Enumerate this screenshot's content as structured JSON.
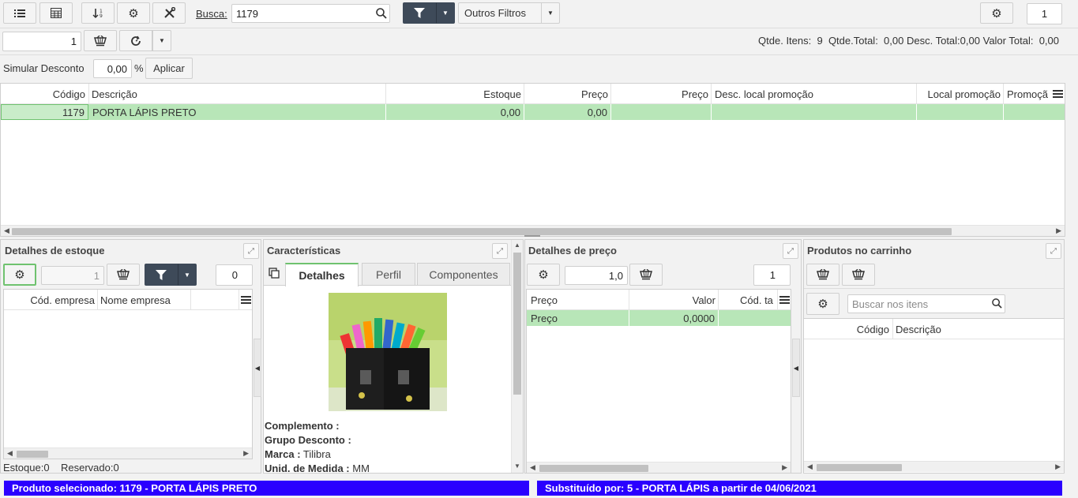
{
  "toolbar": {
    "search_label": "Busca:",
    "search_value": "1179",
    "other_filters_label": "Outros Filtros",
    "page_number": "1"
  },
  "row2": {
    "quantity_value": "1",
    "summary": {
      "items_label": "Qtde. Itens:",
      "items_value": "9",
      "total_label": "Qtde.Total:",
      "total_value": "0,00",
      "desc_label": "Desc. Total:",
      "desc_value": "0,00",
      "valor_label": "Valor Total:",
      "valor_value": "0,00"
    }
  },
  "discount": {
    "label": "Simular Desconto",
    "value": "0,00",
    "percent": "%",
    "apply_label": "Aplicar"
  },
  "main_table": {
    "headers": [
      "Código",
      "Descrição",
      "Estoque",
      "Preço",
      "Preço",
      "Desc. local promoção",
      "Local promoção",
      "Promoçã"
    ],
    "rows": [
      {
        "codigo": "1179",
        "descricao": "PORTA LÁPIS PRETO",
        "estoque": "0,00",
        "preco": "0,00"
      }
    ]
  },
  "stock_panel": {
    "title": "Detalhes de estoque",
    "qty_value": "1",
    "count_value": "0",
    "headers": [
      "Cód. empresa",
      "Nome empresa"
    ],
    "footer_stock": "Estoque:0",
    "footer_reserved": "Reservado:0"
  },
  "features_panel": {
    "title": "Características",
    "tabs": [
      "Detalhes",
      "Perfil",
      "Componentes"
    ],
    "fields": [
      {
        "label": "Complemento :",
        "value": ""
      },
      {
        "label": "Grupo Desconto :",
        "value": ""
      },
      {
        "label": "Marca :",
        "value": "Tilibra"
      },
      {
        "label": "Unid. de Medida :",
        "value": "MM"
      }
    ]
  },
  "price_panel": {
    "title": "Detalhes de preço",
    "qty_value": "1,0",
    "count_value": "1",
    "headers": [
      "Preço",
      "Valor",
      "Cód. ta"
    ],
    "rows": [
      {
        "preco": "Preço",
        "valor": "0,0000"
      }
    ]
  },
  "cart_panel": {
    "title": "Produtos no carrinho",
    "search_placeholder": "Buscar nos itens",
    "headers": [
      "Código",
      "Descrição"
    ]
  },
  "status_bar": {
    "selected": "Produto selecionado: 1179 - PORTA LÁPIS PRETO",
    "substituted": "Substituído por: 5 - PORTA LÁPIS a partir de 04/06/2021"
  },
  "colors": {
    "selected_row": "#b8e6b8",
    "dark_button": "#3e4a59",
    "status_bar": "#2a00ff"
  }
}
